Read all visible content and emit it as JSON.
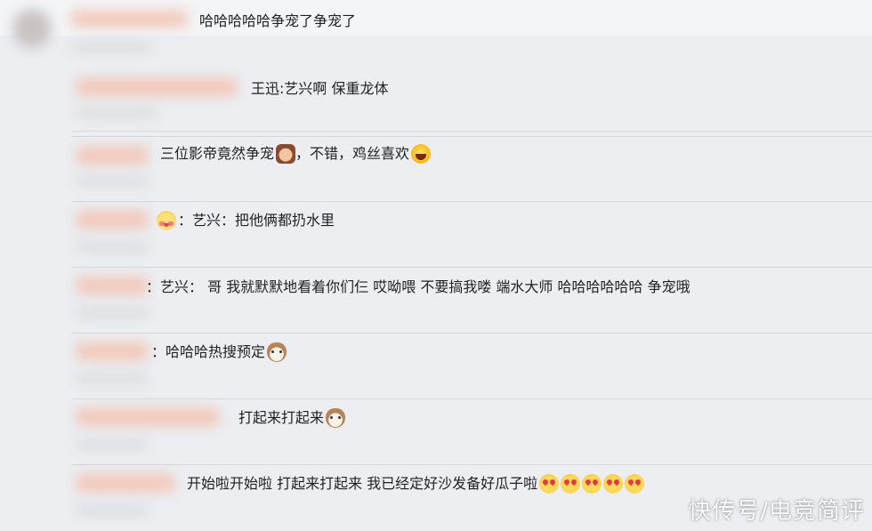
{
  "comments": [
    {
      "text": "哈哈哈哈哈争宠了争宠了",
      "emojis": []
    },
    {
      "text": "王迅:艺兴啊 保重龙体",
      "emojis": []
    },
    {
      "text": "三位影帝竟然争宠",
      "text2": "，不错，鸡丝喜欢",
      "emojis": [
        "person-icon",
        "laugh-icon"
      ]
    },
    {
      "text": "：艺兴：把他俩都扔水里",
      "emojis": [
        "blush-icon"
      ]
    },
    {
      "text": "：艺兴：  哥 我就默默地看着你们仨  哎呦喂 不要搞我喽 端水大师 哈哈哈哈哈哈 争宠哦",
      "emojis": []
    },
    {
      "text": "：哈哈哈热搜预定",
      "emojis": [
        "cat-icon"
      ]
    },
    {
      "text": "打起来打起来",
      "emojis": [
        "cat-icon"
      ]
    },
    {
      "text": "开始啦开始啦 打起来打起来  我已经定好沙发备好瓜子啦",
      "emojis": [
        "heart-eyes-icon",
        "heart-eyes-icon",
        "heart-eyes-icon",
        "heart-eyes-icon",
        "heart-eyes-icon"
      ]
    }
  ],
  "watermark": "快传号/电竞简评",
  "colors": {
    "background": "#eceef2",
    "text": "#222222",
    "divider": "#d6d8dd"
  }
}
